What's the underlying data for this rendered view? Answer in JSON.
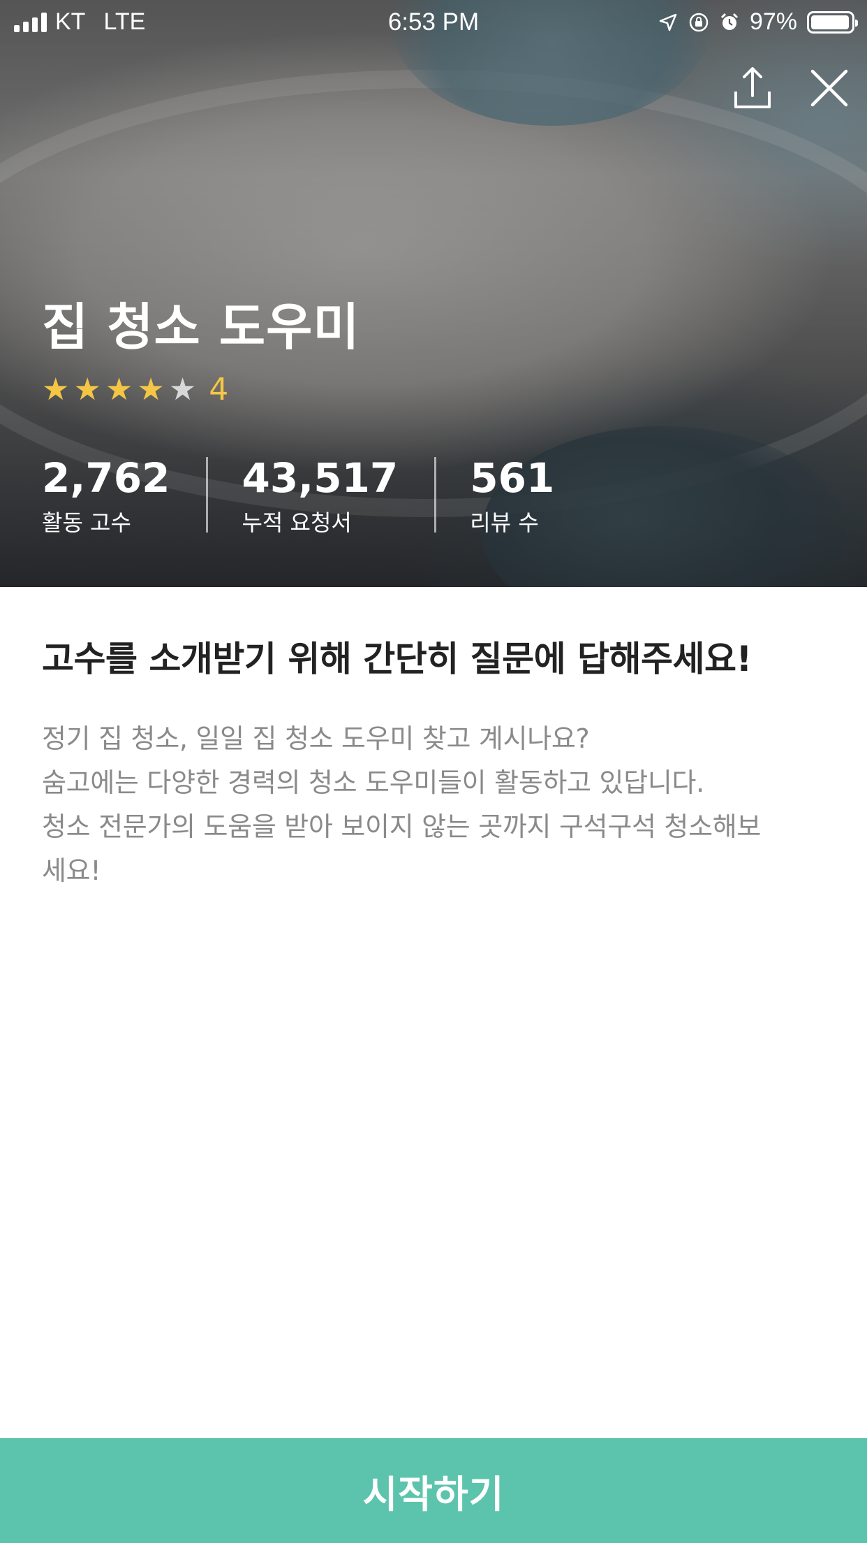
{
  "status_bar": {
    "carrier": "KT",
    "network": "LTE",
    "time": "6:53 PM",
    "battery_percent": "97%",
    "battery_level": 0.97,
    "icons": [
      "location-arrow-icon",
      "rotation-lock-icon",
      "alarm-icon"
    ]
  },
  "actions": {
    "share_icon": "share-icon",
    "close_icon": "close-icon"
  },
  "hero": {
    "title": "집 청소 도우미",
    "rating": {
      "value": "4",
      "stars_filled": 4,
      "stars_total": 5,
      "star_color": "#f5c645"
    },
    "stats": [
      {
        "value": "2,762",
        "label": "활동 고수"
      },
      {
        "value": "43,517",
        "label": "누적 요청서"
      },
      {
        "value": "561",
        "label": "리뷰 수"
      }
    ]
  },
  "intro": {
    "title": "고수를 소개받기 위해 간단히 질문에 답해주세요!",
    "lines": [
      "정기 집 청소, 일일 집 청소 도우미 찾고 계시나요?",
      "숨고에는 다양한 경력의 청소 도우미들이 활동하고 있답니다.",
      "청소 전문가의 도움을 받아 보이지 않는 곳까지 구석구석 청소해보",
      "세요!"
    ]
  },
  "cta": {
    "label": "시작하기",
    "color": "#5cc4ad"
  }
}
